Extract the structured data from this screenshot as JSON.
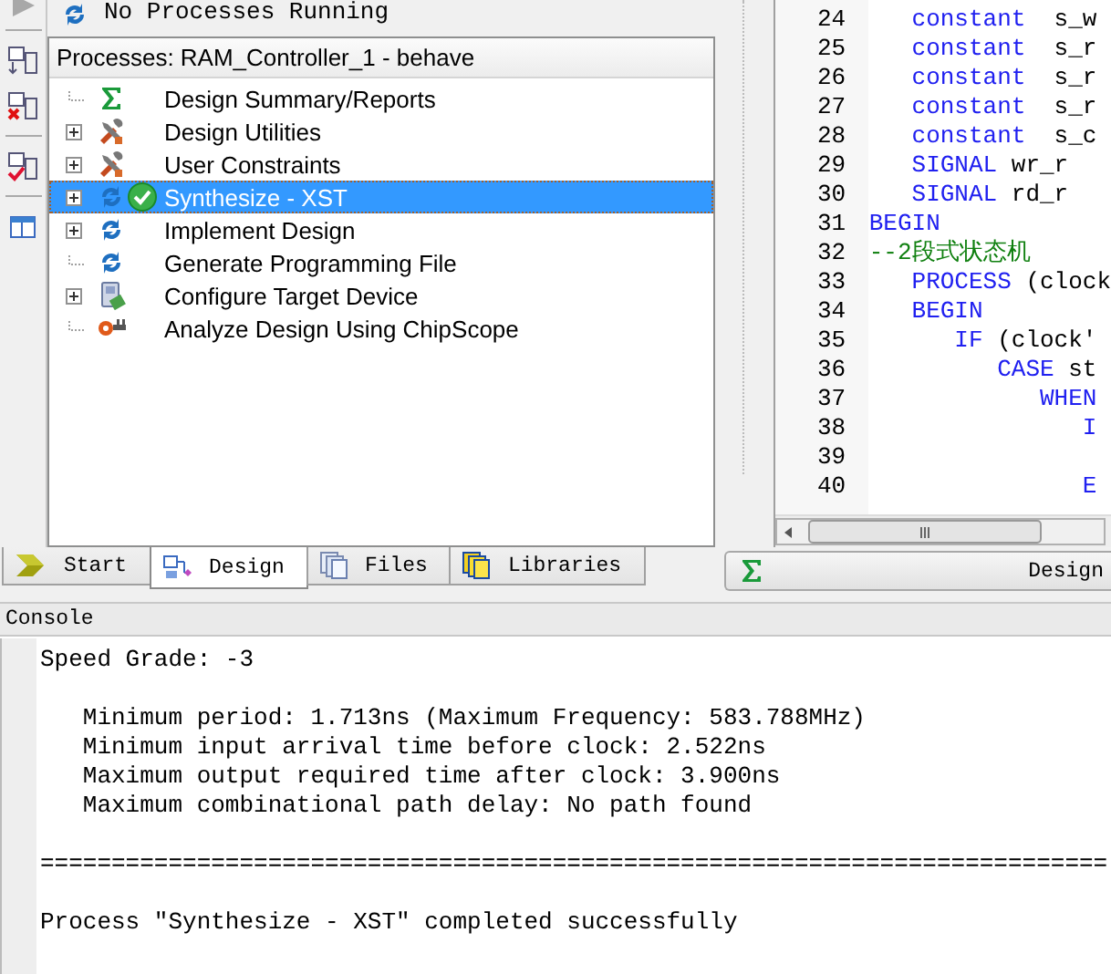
{
  "status_line": {
    "text": "No Processes Running"
  },
  "toolbar": [
    {
      "kind": "arrow"
    },
    {
      "kind": "add"
    },
    {
      "kind": "remove"
    },
    {
      "kind": "check"
    },
    {
      "kind": "window"
    }
  ],
  "processes": {
    "title": "Processes: RAM_Controller_1 - behave",
    "items": [
      {
        "label": "Design Summary/Reports",
        "kind": "sigma",
        "expandable": false,
        "selected": false,
        "succeeded": false
      },
      {
        "label": "Design Utilities",
        "kind": "tools",
        "expandable": true,
        "selected": false,
        "succeeded": false
      },
      {
        "label": "User Constraints",
        "kind": "tools",
        "expandable": true,
        "selected": false,
        "succeeded": false
      },
      {
        "label": "Synthesize - XST",
        "kind": "refresh",
        "expandable": true,
        "selected": true,
        "succeeded": true
      },
      {
        "label": "Implement Design",
        "kind": "refresh",
        "expandable": true,
        "selected": false,
        "succeeded": false
      },
      {
        "label": "Generate Programming File",
        "kind": "refresh",
        "expandable": false,
        "selected": false,
        "succeeded": false
      },
      {
        "label": "Configure Target Device",
        "kind": "device",
        "expandable": true,
        "selected": false,
        "succeeded": false
      },
      {
        "label": "Analyze Design Using ChipScope",
        "kind": "probe",
        "expandable": false,
        "selected": false,
        "succeeded": false
      }
    ]
  },
  "editor": {
    "lines": [
      {
        "number": "24",
        "tokens": [
          {
            "kind": "keyword",
            "text": "   constant"
          },
          {
            "kind": "plain",
            "text": "  s_w"
          }
        ]
      },
      {
        "number": "25",
        "tokens": [
          {
            "kind": "keyword",
            "text": "   constant"
          },
          {
            "kind": "plain",
            "text": "  s_r"
          }
        ]
      },
      {
        "number": "26",
        "tokens": [
          {
            "kind": "keyword",
            "text": "   constant"
          },
          {
            "kind": "plain",
            "text": "  s_r"
          }
        ]
      },
      {
        "number": "27",
        "tokens": [
          {
            "kind": "keyword",
            "text": "   constant"
          },
          {
            "kind": "plain",
            "text": "  s_r"
          }
        ]
      },
      {
        "number": "28",
        "tokens": [
          {
            "kind": "keyword",
            "text": "   constant"
          },
          {
            "kind": "plain",
            "text": "  s_c"
          }
        ]
      },
      {
        "number": "29",
        "tokens": [
          {
            "kind": "keyword",
            "text": "   SIGNAL"
          },
          {
            "kind": "plain",
            "text": " wr_r"
          }
        ]
      },
      {
        "number": "30",
        "tokens": [
          {
            "kind": "keyword",
            "text": "   SIGNAL"
          },
          {
            "kind": "plain",
            "text": " rd_r"
          }
        ]
      },
      {
        "number": "31",
        "tokens": [
          {
            "kind": "keyword",
            "text": "BEGIN"
          }
        ]
      },
      {
        "number": "32",
        "tokens": [
          {
            "kind": "comment",
            "text": "--2段式状态机"
          }
        ]
      },
      {
        "number": "33",
        "tokens": [
          {
            "kind": "keyword",
            "text": "   PROCESS"
          },
          {
            "kind": "plain",
            "text": " (clock"
          }
        ]
      },
      {
        "number": "34",
        "tokens": [
          {
            "kind": "keyword",
            "text": "   BEGIN"
          }
        ]
      },
      {
        "number": "35",
        "tokens": [
          {
            "kind": "keyword",
            "text": "      IF"
          },
          {
            "kind": "plain",
            "text": " (clock'"
          }
        ]
      },
      {
        "number": "36",
        "tokens": [
          {
            "kind": "keyword",
            "text": "         CASE"
          },
          {
            "kind": "plain",
            "text": " st"
          }
        ]
      },
      {
        "number": "37",
        "tokens": [
          {
            "kind": "keyword",
            "text": "            WHEN"
          }
        ]
      },
      {
        "number": "38",
        "tokens": [
          {
            "kind": "keyword",
            "text": "               I"
          }
        ]
      },
      {
        "number": "39"
      },
      {
        "number": "40",
        "tokens": [
          {
            "kind": "keyword",
            "text": "               E"
          }
        ]
      }
    ]
  },
  "tabs": [
    {
      "label": "Start",
      "kind": "start",
      "selected": false
    },
    {
      "label": "Design",
      "kind": "design",
      "selected": true
    },
    {
      "label": "Files",
      "kind": "files",
      "selected": false
    },
    {
      "label": "Libraries",
      "kind": "libraries",
      "selected": false
    }
  ],
  "editor_tab": {
    "label": "Design"
  },
  "console": {
    "title": "Console",
    "blocks": [
      [
        "Speed Grade: -3"
      ],
      [
        "   Minimum period: 1.713ns (Maximum Frequency: 583.788MHz)",
        "   Minimum input arrival time before clock: 2.522ns",
        "   Maximum output required time after clock: 3.900ns",
        "   Maximum combinational path delay: No path found"
      ],
      [
        "==========================================================================="
      ],
      [
        "Process \"Synthesize - XST\" completed successfully"
      ]
    ]
  }
}
